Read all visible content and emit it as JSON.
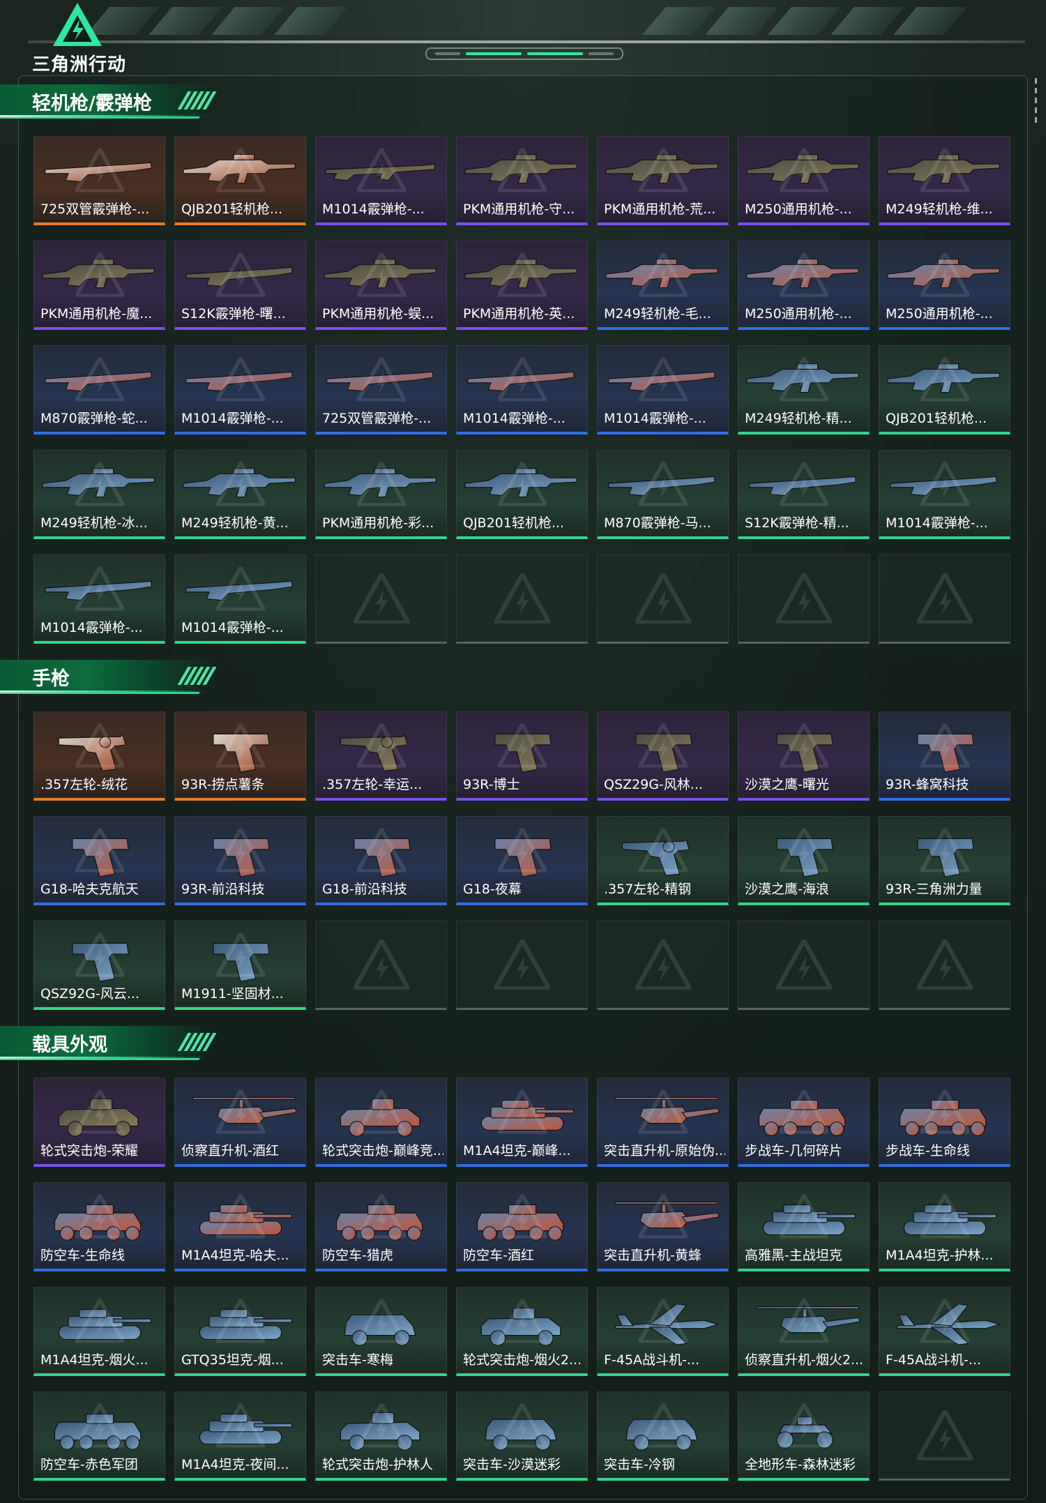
{
  "app": {
    "logo_text": "三角洲行动"
  },
  "colors": {
    "gold": "#e87b23",
    "purple": "#7c4ff0",
    "blue": "#2f6fe8",
    "green": "#2fd58c",
    "accent": "#2fe6a0"
  },
  "sections": [
    {
      "title": "轻机枪/霰弹枪",
      "kind": "gun",
      "items": [
        {
          "label": "725双管霰弹枪-...",
          "rarity": "gold",
          "icon": "shotgun-icon"
        },
        {
          "label": "QJB201轻机枪...",
          "rarity": "gold",
          "icon": "lmg-icon"
        },
        {
          "label": "M1014霰弹枪-...",
          "rarity": "purple",
          "icon": "rifle-icon"
        },
        {
          "label": "PKM通用机枪-守...",
          "rarity": "purple",
          "icon": "lmg-icon"
        },
        {
          "label": "PKM通用机枪-荒...",
          "rarity": "purple",
          "icon": "lmg-icon"
        },
        {
          "label": "M250通用机枪-...",
          "rarity": "purple",
          "icon": "lmg-icon"
        },
        {
          "label": "M249轻机枪-维...",
          "rarity": "purple",
          "icon": "lmg-icon"
        },
        {
          "label": "PKM通用机枪-魔...",
          "rarity": "purple",
          "icon": "lmg-icon"
        },
        {
          "label": "S12K霰弹枪-曙...",
          "rarity": "purple",
          "icon": "shotgun-icon"
        },
        {
          "label": "PKM通用机枪-蜈...",
          "rarity": "purple",
          "icon": "lmg-icon"
        },
        {
          "label": "PKM通用机枪-英...",
          "rarity": "purple",
          "icon": "lmg-icon"
        },
        {
          "label": "M249轻机枪-毛...",
          "rarity": "blue",
          "icon": "lmg-icon"
        },
        {
          "label": "M250通用机枪-...",
          "rarity": "blue",
          "icon": "lmg-icon"
        },
        {
          "label": "M250通用机枪-...",
          "rarity": "blue",
          "icon": "lmg-icon"
        },
        {
          "label": "M870霰弹枪-蛇...",
          "rarity": "blue",
          "icon": "shotgun-icon"
        },
        {
          "label": "M1014霰弹枪-...",
          "rarity": "blue",
          "icon": "shotgun-icon"
        },
        {
          "label": "725双管霰弹枪-...",
          "rarity": "blue",
          "icon": "shotgun-icon"
        },
        {
          "label": "M1014霰弹枪-...",
          "rarity": "blue",
          "icon": "shotgun-icon"
        },
        {
          "label": "M1014霰弹枪-...",
          "rarity": "blue",
          "icon": "shotgun-icon"
        },
        {
          "label": "M249轻机枪-精...",
          "rarity": "green",
          "icon": "lmg-icon"
        },
        {
          "label": "QJB201轻机枪...",
          "rarity": "green",
          "icon": "lmg-icon"
        },
        {
          "label": "M249轻机枪-冰...",
          "rarity": "green",
          "icon": "lmg-icon"
        },
        {
          "label": "M249轻机枪-黄...",
          "rarity": "green",
          "icon": "lmg-icon"
        },
        {
          "label": "PKM通用机枪-彩...",
          "rarity": "green",
          "icon": "lmg-icon"
        },
        {
          "label": "QJB201轻机枪...",
          "rarity": "green",
          "icon": "lmg-icon"
        },
        {
          "label": "M870霰弹枪-马...",
          "rarity": "green",
          "icon": "shotgun-icon"
        },
        {
          "label": "S12K霰弹枪-精...",
          "rarity": "green",
          "icon": "shotgun-icon"
        },
        {
          "label": "M1014霰弹枪-...",
          "rarity": "green",
          "icon": "shotgun-icon"
        },
        {
          "label": "M1014霰弹枪-...",
          "rarity": "green",
          "icon": "shotgun-icon"
        },
        {
          "label": "M1014霰弹枪-...",
          "rarity": "green",
          "icon": "shotgun-icon"
        }
      ],
      "empty_slots": 5
    },
    {
      "title": "手枪",
      "kind": "pistol",
      "items": [
        {
          "label": ".357左轮-绒花",
          "rarity": "gold",
          "icon": "revolver-icon"
        },
        {
          "label": "93R-捞点薯条",
          "rarity": "gold",
          "icon": "pistol-icon"
        },
        {
          "label": ".357左轮-幸运...",
          "rarity": "purple",
          "icon": "revolver-icon"
        },
        {
          "label": "93R-博士",
          "rarity": "purple",
          "icon": "pistol-icon"
        },
        {
          "label": "QSZ29G-风林...",
          "rarity": "purple",
          "icon": "pistol-icon"
        },
        {
          "label": "沙漠之鹰-曙光",
          "rarity": "purple",
          "icon": "pistol-icon"
        },
        {
          "label": "93R-蜂窝科技",
          "rarity": "blue",
          "icon": "pistol-icon"
        },
        {
          "label": "G18-哈夫克航天",
          "rarity": "blue",
          "icon": "pistol-icon"
        },
        {
          "label": "93R-前沿科技",
          "rarity": "blue",
          "icon": "pistol-icon"
        },
        {
          "label": "G18-前沿科技",
          "rarity": "blue",
          "icon": "pistol-icon"
        },
        {
          "label": "G18-夜幕",
          "rarity": "blue",
          "icon": "pistol-icon"
        },
        {
          "label": ".357左轮-精钢",
          "rarity": "green",
          "icon": "revolver-icon"
        },
        {
          "label": "沙漠之鹰-海浪",
          "rarity": "green",
          "icon": "pistol-icon"
        },
        {
          "label": "93R-三角洲力量",
          "rarity": "green",
          "icon": "pistol-icon"
        },
        {
          "label": "QSZ92G-风云...",
          "rarity": "green",
          "icon": "pistol-icon"
        },
        {
          "label": "M1911-坚固材...",
          "rarity": "green",
          "icon": "pistol-icon"
        }
      ],
      "empty_slots": 5
    },
    {
      "title": "载具外观",
      "kind": "vehicle",
      "items": [
        {
          "label": "轮式突击炮-荣耀",
          "rarity": "purple",
          "icon": "armored-car-icon"
        },
        {
          "label": "侦察直升机-酒红",
          "rarity": "blue",
          "icon": "helicopter-icon"
        },
        {
          "label": "轮式突击炮-巅峰竞...",
          "rarity": "blue",
          "icon": "armored-car-icon"
        },
        {
          "label": "M1A4坦克-巅峰...",
          "rarity": "blue",
          "icon": "tank-icon"
        },
        {
          "label": "突击直升机-原始伪...",
          "rarity": "blue",
          "icon": "helicopter-icon"
        },
        {
          "label": "步战车-几何碎片",
          "rarity": "blue",
          "icon": "apc-icon"
        },
        {
          "label": "步战车-生命线",
          "rarity": "blue",
          "icon": "apc-icon"
        },
        {
          "label": "防空车-生命线",
          "rarity": "blue",
          "icon": "apc-icon"
        },
        {
          "label": "M1A4坦克-哈夫...",
          "rarity": "blue",
          "icon": "tank-icon"
        },
        {
          "label": "防空车-猎虎",
          "rarity": "blue",
          "icon": "apc-icon"
        },
        {
          "label": "防空车-酒红",
          "rarity": "blue",
          "icon": "apc-icon"
        },
        {
          "label": "突击直升机-黄蜂",
          "rarity": "blue",
          "icon": "helicopter-icon"
        },
        {
          "label": "高雅黑-主战坦克",
          "rarity": "green",
          "icon": "tank-icon"
        },
        {
          "label": "M1A4坦克-护林...",
          "rarity": "green",
          "icon": "tank-icon"
        },
        {
          "label": "M1A4坦克-烟火...",
          "rarity": "green",
          "icon": "tank-icon"
        },
        {
          "label": "GTQ35坦克-烟...",
          "rarity": "green",
          "icon": "tank-icon"
        },
        {
          "label": "突击车-寒梅",
          "rarity": "green",
          "icon": "jeep-icon"
        },
        {
          "label": "轮式突击炮-烟火2...",
          "rarity": "green",
          "icon": "armored-car-icon"
        },
        {
          "label": "F-45A战斗机-...",
          "rarity": "green",
          "icon": "jet-icon"
        },
        {
          "label": "侦察直升机-烟火2...",
          "rarity": "green",
          "icon": "helicopter-icon"
        },
        {
          "label": "F-45A战斗机-...",
          "rarity": "green",
          "icon": "jet-icon"
        },
        {
          "label": "防空车-赤色军团",
          "rarity": "green",
          "icon": "apc-icon"
        },
        {
          "label": "M1A4坦克-夜间...",
          "rarity": "green",
          "icon": "tank-icon"
        },
        {
          "label": "轮式突击炮-护林人",
          "rarity": "green",
          "icon": "armored-car-icon"
        },
        {
          "label": "突击车-沙漠迷彩",
          "rarity": "green",
          "icon": "jeep-icon"
        },
        {
          "label": "突击车-冷钢",
          "rarity": "green",
          "icon": "jeep-icon"
        },
        {
          "label": "全地形车-森林迷彩",
          "rarity": "green",
          "icon": "atv-icon"
        }
      ],
      "empty_slots": 1
    }
  ]
}
